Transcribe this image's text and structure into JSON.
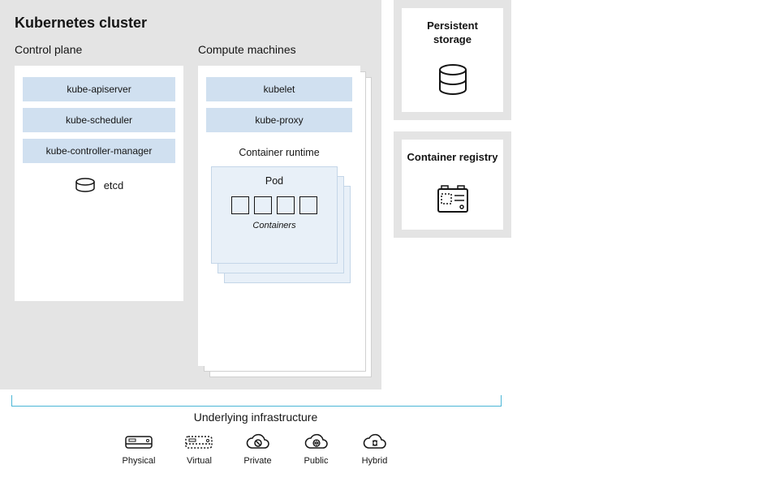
{
  "cluster": {
    "title": "Kubernetes cluster",
    "control": {
      "title": "Control plane",
      "components": [
        "kube-apiserver",
        "kube-scheduler",
        "kube-controller-manager"
      ],
      "store": "etcd"
    },
    "compute": {
      "title": "Compute machines",
      "components": [
        "kubelet",
        "kube-proxy"
      ],
      "runtime_title": "Container runtime",
      "pod_title": "Pod",
      "containers_label": "Containers"
    }
  },
  "side": {
    "storage": {
      "title": "Persistent storage"
    },
    "registry": {
      "title": "Container registry"
    }
  },
  "infra": {
    "title": "Underlying infrastructure",
    "items": [
      {
        "label": "Physical",
        "icon": "physical"
      },
      {
        "label": "Virtual",
        "icon": "virtual"
      },
      {
        "label": "Private",
        "icon": "private"
      },
      {
        "label": "Public",
        "icon": "public"
      },
      {
        "label": "Hybrid",
        "icon": "hybrid"
      }
    ]
  }
}
